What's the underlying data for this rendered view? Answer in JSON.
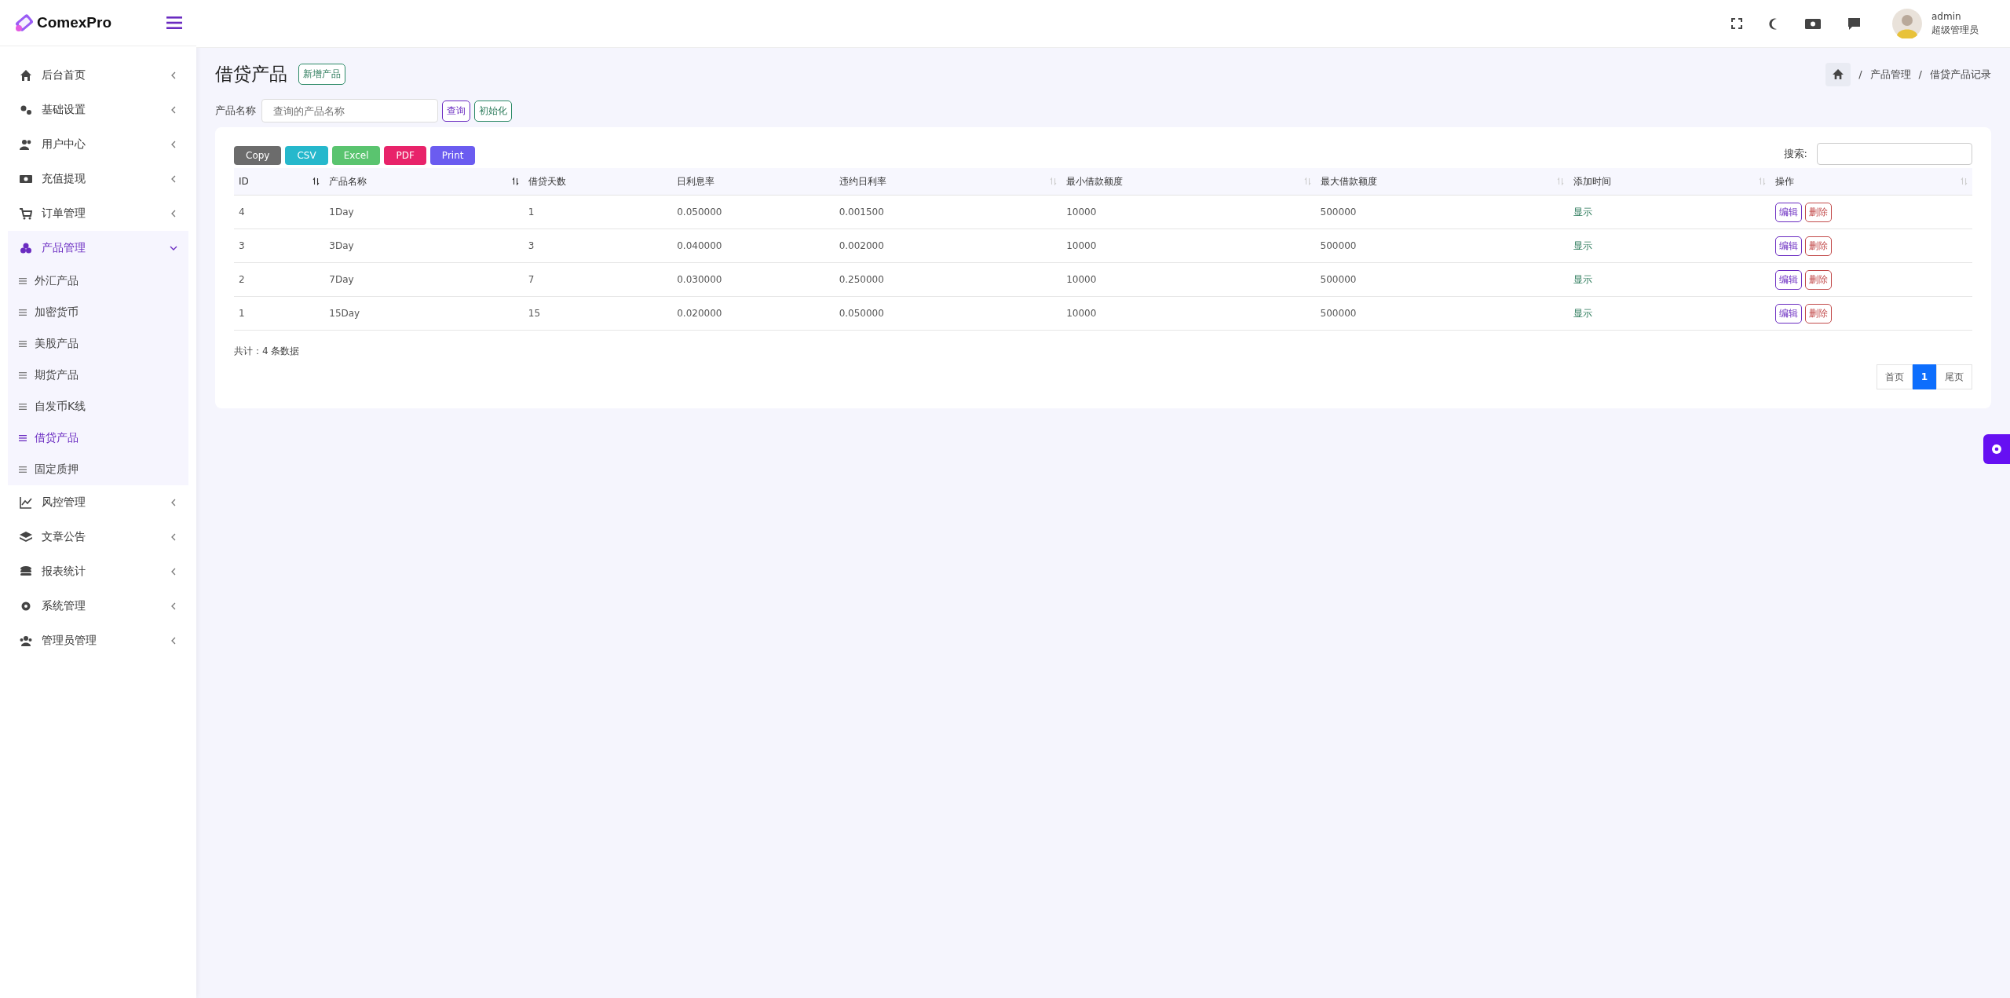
{
  "brand": {
    "name": "ComexPro"
  },
  "sidebar": {
    "items": [
      {
        "label": "后台首页",
        "expanded": false
      },
      {
        "label": "基础设置",
        "expanded": false
      },
      {
        "label": "用户中心",
        "expanded": false
      },
      {
        "label": "充值提现",
        "expanded": false
      },
      {
        "label": "订单管理",
        "expanded": false
      },
      {
        "label": "产品管理",
        "expanded": true,
        "children": [
          {
            "label": "外汇产品",
            "selected": false
          },
          {
            "label": "加密货币",
            "selected": false
          },
          {
            "label": "美股产品",
            "selected": false
          },
          {
            "label": "期货产品",
            "selected": false
          },
          {
            "label": "自发币K线",
            "selected": false
          },
          {
            "label": "借贷产品",
            "selected": true
          },
          {
            "label": "固定质押",
            "selected": false
          }
        ]
      },
      {
        "label": "风控管理",
        "expanded": false
      },
      {
        "label": "文章公告",
        "expanded": false
      },
      {
        "label": "报表统计",
        "expanded": false
      },
      {
        "label": "系统管理",
        "expanded": false
      },
      {
        "label": "管理员管理",
        "expanded": false
      }
    ]
  },
  "user": {
    "name": "admin",
    "role": "超级管理员"
  },
  "page": {
    "title": "借贷产品",
    "add_button": "新增产品"
  },
  "breadcrumb": {
    "separator": "/",
    "items": [
      "产品管理",
      "借贷产品记录"
    ]
  },
  "filter": {
    "label": "产品名称",
    "placeholder": "查询的产品名称",
    "search_button": "查询",
    "reset_button": "初始化"
  },
  "export_buttons": [
    {
      "label": "Copy",
      "color": "#6c6c6c"
    },
    {
      "label": "CSV",
      "color": "#26b8cc"
    },
    {
      "label": "Excel",
      "color": "#5ac46f"
    },
    {
      "label": "PDF",
      "color": "#e8236a"
    },
    {
      "label": "Print",
      "color": "#6b5cf0"
    }
  ],
  "search": {
    "label": "搜索:"
  },
  "table": {
    "columns": [
      {
        "label": "ID",
        "sortable": true,
        "sorted": true
      },
      {
        "label": "产品名称",
        "sortable": true,
        "sorted": true
      },
      {
        "label": "借贷天数",
        "sortable": false
      },
      {
        "label": "日利息率",
        "sortable": false
      },
      {
        "label": "违约日利率",
        "sortable": true,
        "sorted": false
      },
      {
        "label": "最小借款额度",
        "sortable": true,
        "sorted": false
      },
      {
        "label": "最大借款额度",
        "sortable": true,
        "sorted": false
      },
      {
        "label": "添加时间",
        "sortable": true,
        "sorted": false
      },
      {
        "label": "操作",
        "sortable": true,
        "sorted": false
      }
    ],
    "rows": [
      {
        "id": "4",
        "name": "1Day",
        "days": "1",
        "daily_rate": "0.050000",
        "penalty_rate": "0.001500",
        "min_amount": "10000",
        "max_amount": "500000",
        "status": "显示",
        "edit": "编辑",
        "delete": "删除"
      },
      {
        "id": "3",
        "name": "3Day",
        "days": "3",
        "daily_rate": "0.040000",
        "penalty_rate": "0.002000",
        "min_amount": "10000",
        "max_amount": "500000",
        "status": "显示",
        "edit": "编辑",
        "delete": "删除"
      },
      {
        "id": "2",
        "name": "7Day",
        "days": "7",
        "daily_rate": "0.030000",
        "penalty_rate": "0.250000",
        "min_amount": "10000",
        "max_amount": "500000",
        "status": "显示",
        "edit": "编辑",
        "delete": "删除"
      },
      {
        "id": "1",
        "name": "15Day",
        "days": "15",
        "daily_rate": "0.020000",
        "penalty_rate": "0.050000",
        "min_amount": "10000",
        "max_amount": "500000",
        "status": "显示",
        "edit": "编辑",
        "delete": "删除"
      }
    ]
  },
  "summary": "共计：4 条数据",
  "pagination": [
    {
      "label": "首页",
      "selected": false
    },
    {
      "label": "1",
      "selected": true
    },
    {
      "label": "尾页",
      "selected": false
    }
  ]
}
